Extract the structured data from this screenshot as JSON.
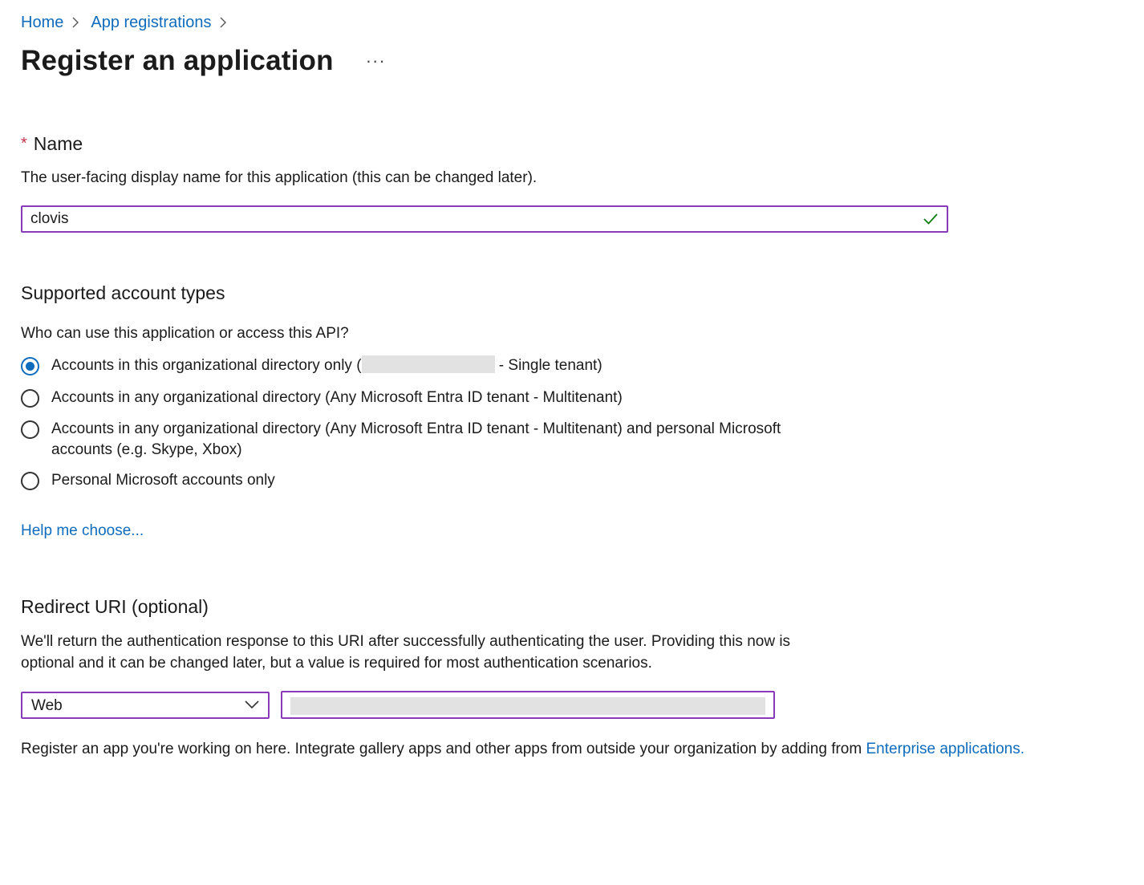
{
  "breadcrumb": {
    "items": [
      {
        "label": "Home"
      },
      {
        "label": "App registrations"
      }
    ]
  },
  "header": {
    "title": "Register an application",
    "more_label": "···"
  },
  "name_section": {
    "required_marker": "*",
    "heading": "Name",
    "description": "The user-facing display name for this application (this can be changed later).",
    "value": "clovis"
  },
  "account_types": {
    "heading": "Supported account types",
    "question": "Who can use this application or access this API?",
    "options": [
      {
        "label_prefix": "Accounts in this organizational directory only (",
        "label_suffix": " - Single tenant)",
        "checked": true
      },
      {
        "label": "Accounts in any organizational directory (Any Microsoft Entra ID tenant - Multitenant)",
        "checked": false
      },
      {
        "label": "Accounts in any organizational directory (Any Microsoft Entra ID tenant - Multitenant) and personal Microsoft accounts (e.g. Skype, Xbox)",
        "checked": false
      },
      {
        "label": "Personal Microsoft accounts only",
        "checked": false
      }
    ],
    "help_link": "Help me choose..."
  },
  "redirect": {
    "heading": "Redirect URI (optional)",
    "description": "We'll return the authentication response to this URI after successfully authenticating the user. Providing this now is optional and it can be changed later, but a value is required for most authentication scenarios.",
    "platform_value": "Web"
  },
  "footer": {
    "text": "Register an app you're working on here. Integrate gallery apps and other apps from outside your organization by adding from ",
    "link": "Enterprise applications",
    "trailing": "."
  },
  "colors": {
    "link": "#0f6cbd",
    "input_border": "#8a3ab9",
    "required": "#c4314b",
    "success_check": "#107c10"
  }
}
